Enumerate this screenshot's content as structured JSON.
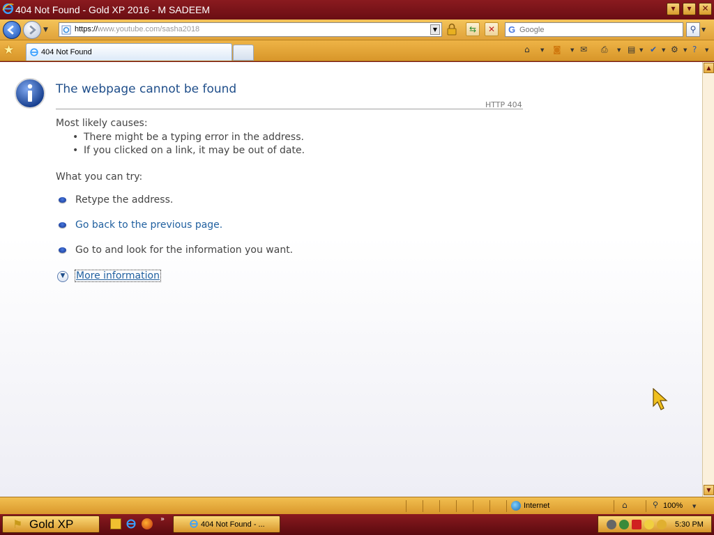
{
  "window": {
    "title": "404 Not Found - Gold XP 2016 - M SADEEM"
  },
  "address": {
    "url_prefix": "https://",
    "url_host": "www.youtube.com",
    "url_path": "/sasha2018"
  },
  "search": {
    "placeholder": "Google"
  },
  "tabs": [
    {
      "label": "404 Not Found"
    }
  ],
  "error_page": {
    "title": "The webpage cannot be found",
    "code": "HTTP 404",
    "causes_heading": "Most likely causes:",
    "causes": [
      "There might be a typing error in the address.",
      "If you clicked on a link, it may be out of date."
    ],
    "try_heading": "What you can try:",
    "try_items": [
      {
        "text": "Retype the address."
      },
      {
        "text": "Go back to the previous page."
      },
      {
        "text": "Go to  and look for the information you want."
      }
    ],
    "more_info": "More information"
  },
  "statusbar": {
    "zone": "Internet",
    "zoom": "100%"
  },
  "taskbar": {
    "start_label": "Gold XP",
    "task_label": "404 Not Found - ...",
    "clock": "5:30 PM"
  },
  "colors": {
    "window_frame": "#7a1016",
    "toolbar_gold": "#e0a23a",
    "title_text": "#1f4e8a",
    "link": "#1f5f9f"
  }
}
